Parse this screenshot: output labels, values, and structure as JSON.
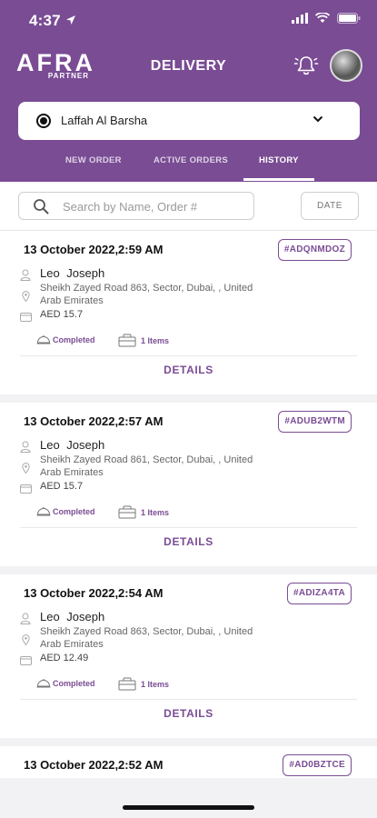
{
  "status_bar": {
    "time": "4:37"
  },
  "header": {
    "logo_main": "AFRA",
    "logo_sub": "PARTNER",
    "title": "DELIVERY"
  },
  "location": {
    "selected": "Laffah Al Barsha"
  },
  "tabs": [
    {
      "label": "NEW ORDER",
      "active": false
    },
    {
      "label": "ACTIVE ORDERS",
      "active": false
    },
    {
      "label": "HISTORY",
      "active": true
    }
  ],
  "search": {
    "placeholder": "Search by Name, Order #",
    "value": ""
  },
  "date_button": "DATE",
  "orders": [
    {
      "date": "13 October 2022,2:59 AM",
      "id": "#ADQNMDOZ",
      "customer": "Leo Joseph",
      "address": "Sheikh Zayed Road 863, Sector, Dubai, , United Arab Emirates",
      "amount": "AED 15.7",
      "status": "Completed",
      "items": "1 Items",
      "details": "DETAILS"
    },
    {
      "date": "13 October 2022,2:57 AM",
      "id": "#ADUB2WTM",
      "customer": "Leo Joseph",
      "address": "Sheikh Zayed Road 861, Sector, Dubai, , United Arab Emirates",
      "amount": "AED 15.7",
      "status": "Completed",
      "items": "1 Items",
      "details": "DETAILS"
    },
    {
      "date": "13 October 2022,2:54 AM",
      "id": "#ADIZA4TA",
      "customer": "Leo Joseph",
      "address": "Sheikh Zayed Road 863, Sector, Dubai, , United Arab Emirates",
      "amount": "AED 12.49",
      "status": "Completed",
      "items": "1 Items",
      "details": "DETAILS"
    },
    {
      "date": "13 October 2022,2:52 AM",
      "id": "#AD0BZTCE"
    }
  ],
  "colors": {
    "brand": "#7a4c94",
    "background": "#f2f2f4"
  }
}
